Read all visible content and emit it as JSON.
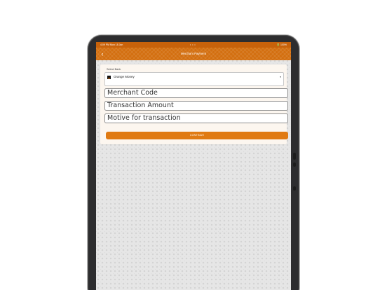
{
  "status_bar": {
    "time": "4:09 PM   Mon 18 Jan",
    "dots": "• • •",
    "right": "🔋 100%"
  },
  "nav": {
    "back_icon": "chevron-left-icon",
    "title": "Merchant Payment"
  },
  "form": {
    "select_label": "Select Bank",
    "selected_bank": "Orange Money",
    "merchant_code_placeholder": "Merchant Code",
    "transaction_amount_placeholder": "Transaction Amount",
    "motive_placeholder": "Motive for transaction",
    "continue_label": "CONTINUE"
  },
  "colors": {
    "accent": "#d36f10",
    "button": "#e07a12",
    "card": "#fcf6ef"
  }
}
